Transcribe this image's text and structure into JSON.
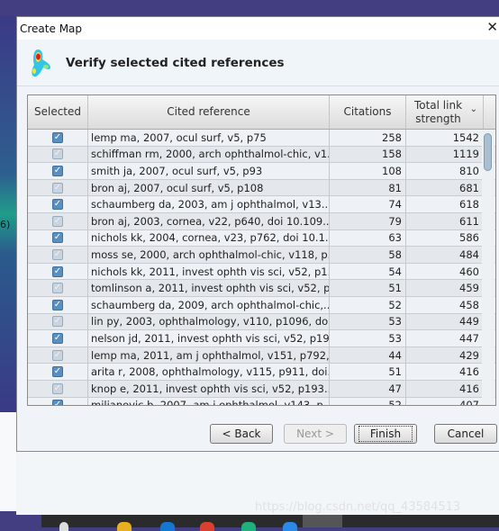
{
  "window": {
    "title": "Create Map",
    "close_icon": "close-icon"
  },
  "header": {
    "title": "Verify selected cited references",
    "logo": "vosviewer-density-logo"
  },
  "background": {
    "side_text": "6)"
  },
  "table": {
    "columns": [
      "Selected",
      "Cited reference",
      "Citations",
      "Total link strength"
    ],
    "sort": {
      "column": "Total link strength",
      "direction": "descending"
    },
    "rows": [
      {
        "selected": true,
        "ref": "lemp ma, 2007, ocul surf, v5, p75",
        "citations": "258",
        "strength": "1542"
      },
      {
        "selected": true,
        "ref": "schiffman rm, 2000, arch ophthalmol-chic, v1...",
        "citations": "158",
        "strength": "1119"
      },
      {
        "selected": true,
        "ref": "smith ja, 2007, ocul surf, v5, p93",
        "citations": "108",
        "strength": "810"
      },
      {
        "selected": true,
        "ref": "bron aj, 2007, ocul surf, v5, p108",
        "citations": "81",
        "strength": "681"
      },
      {
        "selected": true,
        "ref": "schaumberg da, 2003, am j ophthalmol, v13...",
        "citations": "74",
        "strength": "618"
      },
      {
        "selected": true,
        "ref": "bron aj, 2003, cornea, v22, p640, doi 10.109...",
        "citations": "79",
        "strength": "611"
      },
      {
        "selected": true,
        "ref": "nichols kk, 2004, cornea, v23, p762, doi 10.1...",
        "citations": "63",
        "strength": "586"
      },
      {
        "selected": true,
        "ref": "moss se, 2000, arch ophthalmol-chic, v118, p...",
        "citations": "58",
        "strength": "484"
      },
      {
        "selected": true,
        "ref": "nichols kk, 2011, invest ophth vis sci, v52, p1...",
        "citations": "54",
        "strength": "460"
      },
      {
        "selected": true,
        "ref": "tomlinson a, 2011, invest ophth vis sci, v52, p...",
        "citations": "51",
        "strength": "459"
      },
      {
        "selected": true,
        "ref": "schaumberg da, 2009, arch ophthalmol-chic,...",
        "citations": "52",
        "strength": "458"
      },
      {
        "selected": true,
        "ref": "lin py, 2003, ophthalmology, v110, p1096, do...",
        "citations": "53",
        "strength": "449"
      },
      {
        "selected": true,
        "ref": "nelson jd, 2011, invest ophth vis sci, v52, p19...",
        "citations": "53",
        "strength": "447"
      },
      {
        "selected": true,
        "ref": "lemp ma, 2011, am j ophthalmol, v151, p792,...",
        "citations": "44",
        "strength": "429"
      },
      {
        "selected": true,
        "ref": "arita r, 2008, ophthalmology, v115, p911, doi...",
        "citations": "51",
        "strength": "416"
      },
      {
        "selected": true,
        "ref": "knop e, 2011, invest ophth vis sci, v52, p193...",
        "citations": "47",
        "strength": "416"
      },
      {
        "selected": true,
        "ref": "miljanovic b, 2007, am j ophthalmol, v143, p...",
        "citations": "52",
        "strength": "407"
      }
    ]
  },
  "buttons": {
    "back": "< Back",
    "next": "Next >",
    "finish": "Finish",
    "cancel": "Cancel"
  },
  "watermark": "https://blog.csdn.net/qq_43584513"
}
